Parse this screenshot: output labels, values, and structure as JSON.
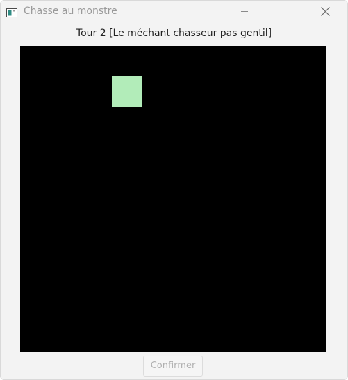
{
  "window": {
    "title": "Chasse au monstre"
  },
  "turn_label": "Tour 2 [Le méchant chasseur pas gentil]",
  "board": {
    "rows": 10,
    "cols": 10,
    "background": "#000000",
    "revealed_cells": [
      {
        "row": 1,
        "col": 3,
        "color": "#b2ecb9"
      }
    ]
  },
  "confirm_button": {
    "label": "Confirmer",
    "disabled": true
  },
  "colors": {
    "window_bg": "#f3f3f3",
    "title_text": "#9a9a9a",
    "cell_revealed": "#b2ecb9"
  }
}
